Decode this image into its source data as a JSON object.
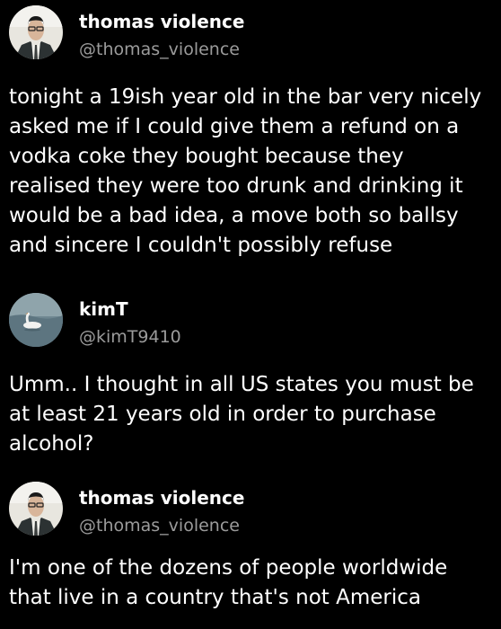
{
  "posts": [
    {
      "author": "thomas violence",
      "handle": "@thomas_violence",
      "avatar_icon": "man-in-suit-avatar",
      "lines": [
        "tonight a 19ish year old in the bar very nicely",
        "asked me if I could give them a refund on a",
        "vodka coke they bought because they",
        "realised they were too drunk and drinking it",
        "would be a bad idea, a move both so ballsy",
        "and sincere I couldn't possibly refuse"
      ]
    },
    {
      "author": "kimT",
      "handle": "@kimT9410",
      "avatar_icon": "swan-on-water-avatar",
      "lines": [
        "Umm.. I thought in all US states you must be",
        "at least 21 years old in order to purchase",
        "alcohol?"
      ]
    },
    {
      "author": "thomas violence",
      "handle": "@thomas_violence",
      "avatar_icon": "man-in-suit-avatar",
      "lines": [
        "I'm one of the dozens of people worldwide",
        "that live in a country that's not America"
      ]
    }
  ],
  "colors": {
    "background": "#000000",
    "text": "#ffffff",
    "handle": "#9b9b9b"
  }
}
